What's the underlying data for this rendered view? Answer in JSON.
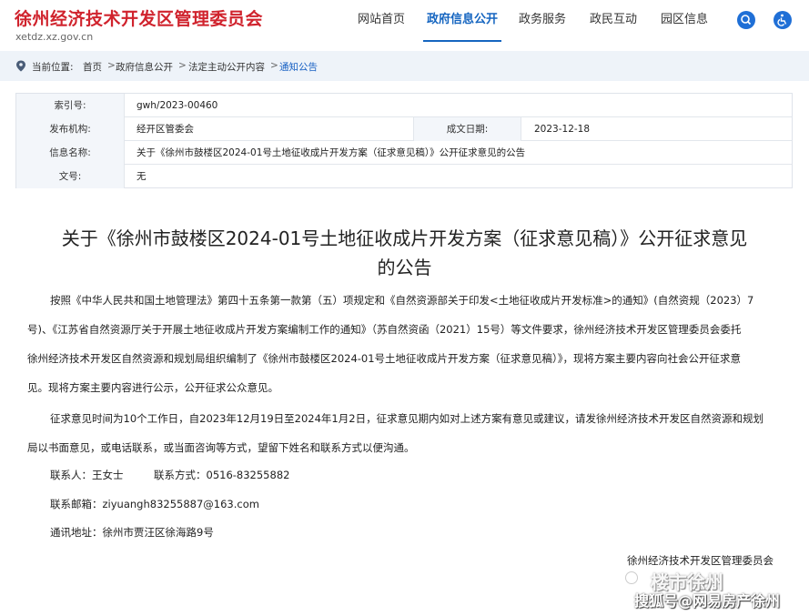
{
  "header": {
    "site_title": "徐州经济技术开发区管理委员会",
    "site_url": "xetdz.xz.gov.cn",
    "nav": [
      "网站首页",
      "政府信息公开",
      "政务服务",
      "政民互动",
      "园区信息"
    ],
    "active_nav": "政府信息公开",
    "accent": "#1565c0",
    "brand": "#d0232d"
  },
  "breadcrumb": {
    "label": "当前位置:",
    "items": [
      "首页",
      "政府信息公开",
      "法定主动公开内容",
      "通知公告"
    ],
    "sep": ">"
  },
  "meta": {
    "index_label": "索引号:",
    "index_value": "gwh/2023-00460",
    "org_label": "发布机构:",
    "org_value": "经开区管委会",
    "date_label": "成文日期:",
    "date_value": "2023-12-18",
    "name_label": "信息名称:",
    "name_value": "关于《徐州市鼓楼区2024-01号土地征收成片开发方案（征求意见稿）》公开征求意见的公告",
    "doc_label": "文号:",
    "doc_value": "无"
  },
  "article": {
    "title_line1": "关于《徐州市鼓楼区2024-01号土地征收成片开发方案（征求意见稿）》公开征求意见",
    "title_line2": "的公告",
    "p1_l1": "按照《中华人民共和国土地管理法》第四十五条第一款第（五）项规定和《自然资源部关于印发<土地征收成片开发标准>的通知》(自然资规（2023）7",
    "p1_l2": "号)、《江苏省自然资源厅关于开展土地征收成片开发方案编制工作的通知》（苏自然资函（2021）15号）等文件要求，徐州经济技术开发区管理委员会委托",
    "p1_l3": "徐州经济技术开发区自然资源和规划局组织编制了《徐州市鼓楼区2024-01号土地征收成片开发方案（征求意见稿）》，现将方案主要内容向社会公开征求意",
    "p1_l4": "见。现将方案主要内容进行公示，公开征求公众意见。",
    "p2_l1": "征求意见时间为10个工作日，自2023年12月19日至2024年1月2日，征求意见期内如对上述方案有意见或建议，请发徐州经济技术开发区自然资源和规划",
    "p2_l2": "局以书面意见，或电话联系，或当面咨询等方式，望留下姓名和联系方式以便沟通。",
    "contact": "联系人：王女士",
    "phone": "联系方式：0516-83255882",
    "email": "联系邮箱：ziyuangh83255887@163.com",
    "address": "通讯地址：徐州市贾汪区徐海路9号",
    "signature": "徐州经济技术开发区管理委员会",
    "sig_date": "2023"
  },
  "watermark": {
    "top": "楼市徐州",
    "bottom": "搜狐号@网易房产徐州"
  }
}
